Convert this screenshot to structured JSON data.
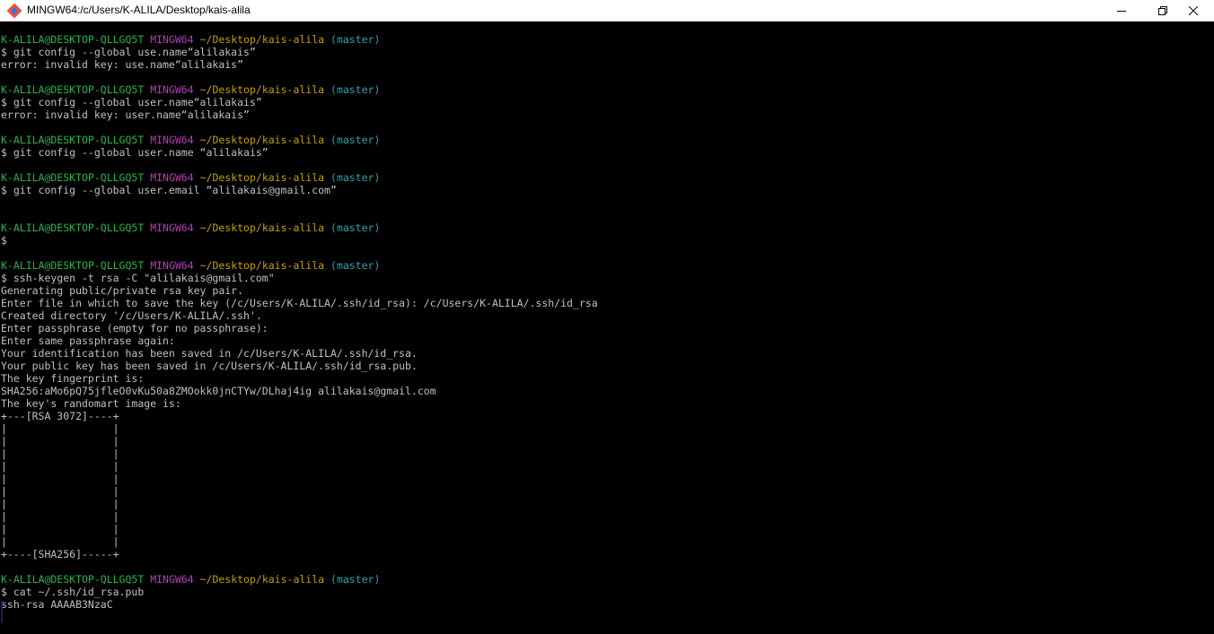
{
  "window": {
    "title": "MINGW64:/c/Users/K-ALILA/Desktop/kais-alila",
    "icon": "git-bash-icon",
    "controls": [
      "minimize-icon",
      "restore-icon",
      "close-icon"
    ]
  },
  "colors": {
    "background": "#000000",
    "text": "#c0c0c0",
    "prompt_user": "#26b545",
    "prompt_system": "#b83ab8",
    "prompt_path": "#c1a000",
    "prompt_branch": "#2aa3b4"
  },
  "prompt": {
    "user": "K-ALILA@DESKTOP-QLLGQ5T",
    "system": "MINGW64",
    "path": "~/Desktop/kais-alila",
    "branch": "(master)"
  },
  "lines": [
    "",
    "$ git config --global use.name“alilakais”",
    "error: invalid key: use.name“alilakais”",
    "",
    "",
    "$ git config --global user.name“alilakais”",
    "error: invalid key: user.name“alilakais”",
    "",
    "",
    "$ git config --global user.name “alilakais”",
    "",
    "",
    "$ git config --global user.email “alilakais@gmail.com”",
    "",
    "",
    "",
    "$",
    "",
    "",
    "$ ssh-keygen -t rsa -C \"alilakais@gmail.com\"",
    "Generating public/private rsa key pair.",
    "Enter file in which to save the key (/c/Users/K-ALILA/.ssh/id_rsa): /c/Users/K-ALILA/.ssh/id_rsa",
    "Created directory '/c/Users/K-ALILA/.ssh'.",
    "Enter passphrase (empty for no passphrase):",
    "Enter same passphrase again:",
    "Your identification has been saved in /c/Users/K-ALILA/.ssh/id_rsa.",
    "Your public key has been saved in /c/Users/K-ALILA/.ssh/id_rsa.pub.",
    "The key fingerprint is:",
    "SHA256:aMo6pQ75jfleO0vKu50a8ZMOokk0jnCTYw/DLhaj4ig alilakais@gmail.com",
    "The key's randomart image is:",
    "+---[RSA 3072]----+",
    "|                 |",
    "|                 |",
    "|                 |",
    "|                 |",
    "|                 |",
    "|                 |",
    "|                 |",
    "|                 |",
    "|                 |",
    "|                 |",
    "+----[SHA256]-----+",
    "",
    "",
    "$ cat ~/.ssh/id_rsa.pub",
    "ssh-rsa AAAAB3NzaC"
  ],
  "prompt_line_numbers": [
    0,
    4,
    8,
    11,
    15,
    18,
    43
  ]
}
